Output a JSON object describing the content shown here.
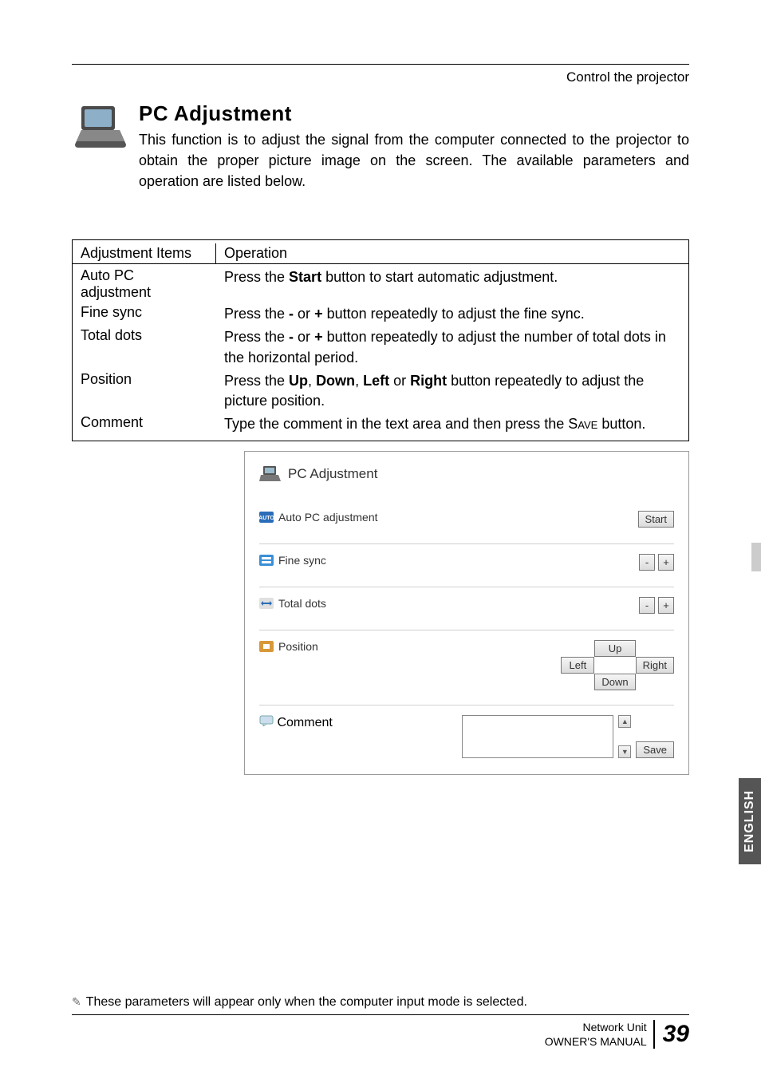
{
  "header": {
    "section": "Control the projector"
  },
  "title": "PC Adjustment",
  "intro": "This function is to adjust the signal from the computer connected to the projector to obtain the proper picture image on the screen. The available parameters and operation are listed below.",
  "table": {
    "head_left": "Adjustment Items",
    "head_right": "Operation",
    "rows": [
      {
        "label": "Auto PC adjustment",
        "op_pre": "Press the ",
        "op_bold1": "Start",
        "op_post": " button to start automatic adjustment."
      },
      {
        "label": "Fine sync",
        "op_pre": "Press the ",
        "op_bold1": "-",
        "op_mid1": " or ",
        "op_bold2": "+",
        "op_post": " button repeatedly to adjust the fine sync."
      },
      {
        "label": "Total dots",
        "op_pre": "Press the ",
        "op_bold1": "-",
        "op_mid1": " or ",
        "op_bold2": "+",
        "op_post": " button repeatedly to adjust the number of total dots in the horizontal period."
      },
      {
        "label": "Position",
        "op_pre": "Press the ",
        "op_bold1": "Up",
        "op_mid1": ", ",
        "op_bold2": "Down",
        "op_mid2": ", ",
        "op_bold3": "Left",
        "op_mid3": " or ",
        "op_bold4": "Right",
        "op_post": " button repeatedly to adjust the picture position."
      },
      {
        "label": "Comment",
        "op_pre": "Type the comment in the text area and then press the ",
        "op_smallcaps": "Save",
        "op_post": " button."
      }
    ]
  },
  "panel": {
    "title": "PC Adjustment",
    "auto_label": "Auto PC adjustment",
    "start_btn": "Start",
    "fine_label": "Fine sync",
    "minus": "-",
    "plus": "+",
    "total_label": "Total dots",
    "position_label": "Position",
    "up": "Up",
    "down": "Down",
    "left": "Left",
    "right": "Right",
    "comment_label": "Comment",
    "save_btn": "Save",
    "scroll_up": "▲",
    "scroll_down": "▼"
  },
  "lang_tab": "ENGLISH",
  "footnote_icon": "✎",
  "footnote": "These parameters will appear only when the computer input mode is selected.",
  "footer": {
    "line1": "Network Unit",
    "line2": "OWNER'S MANUAL",
    "page": "39"
  }
}
